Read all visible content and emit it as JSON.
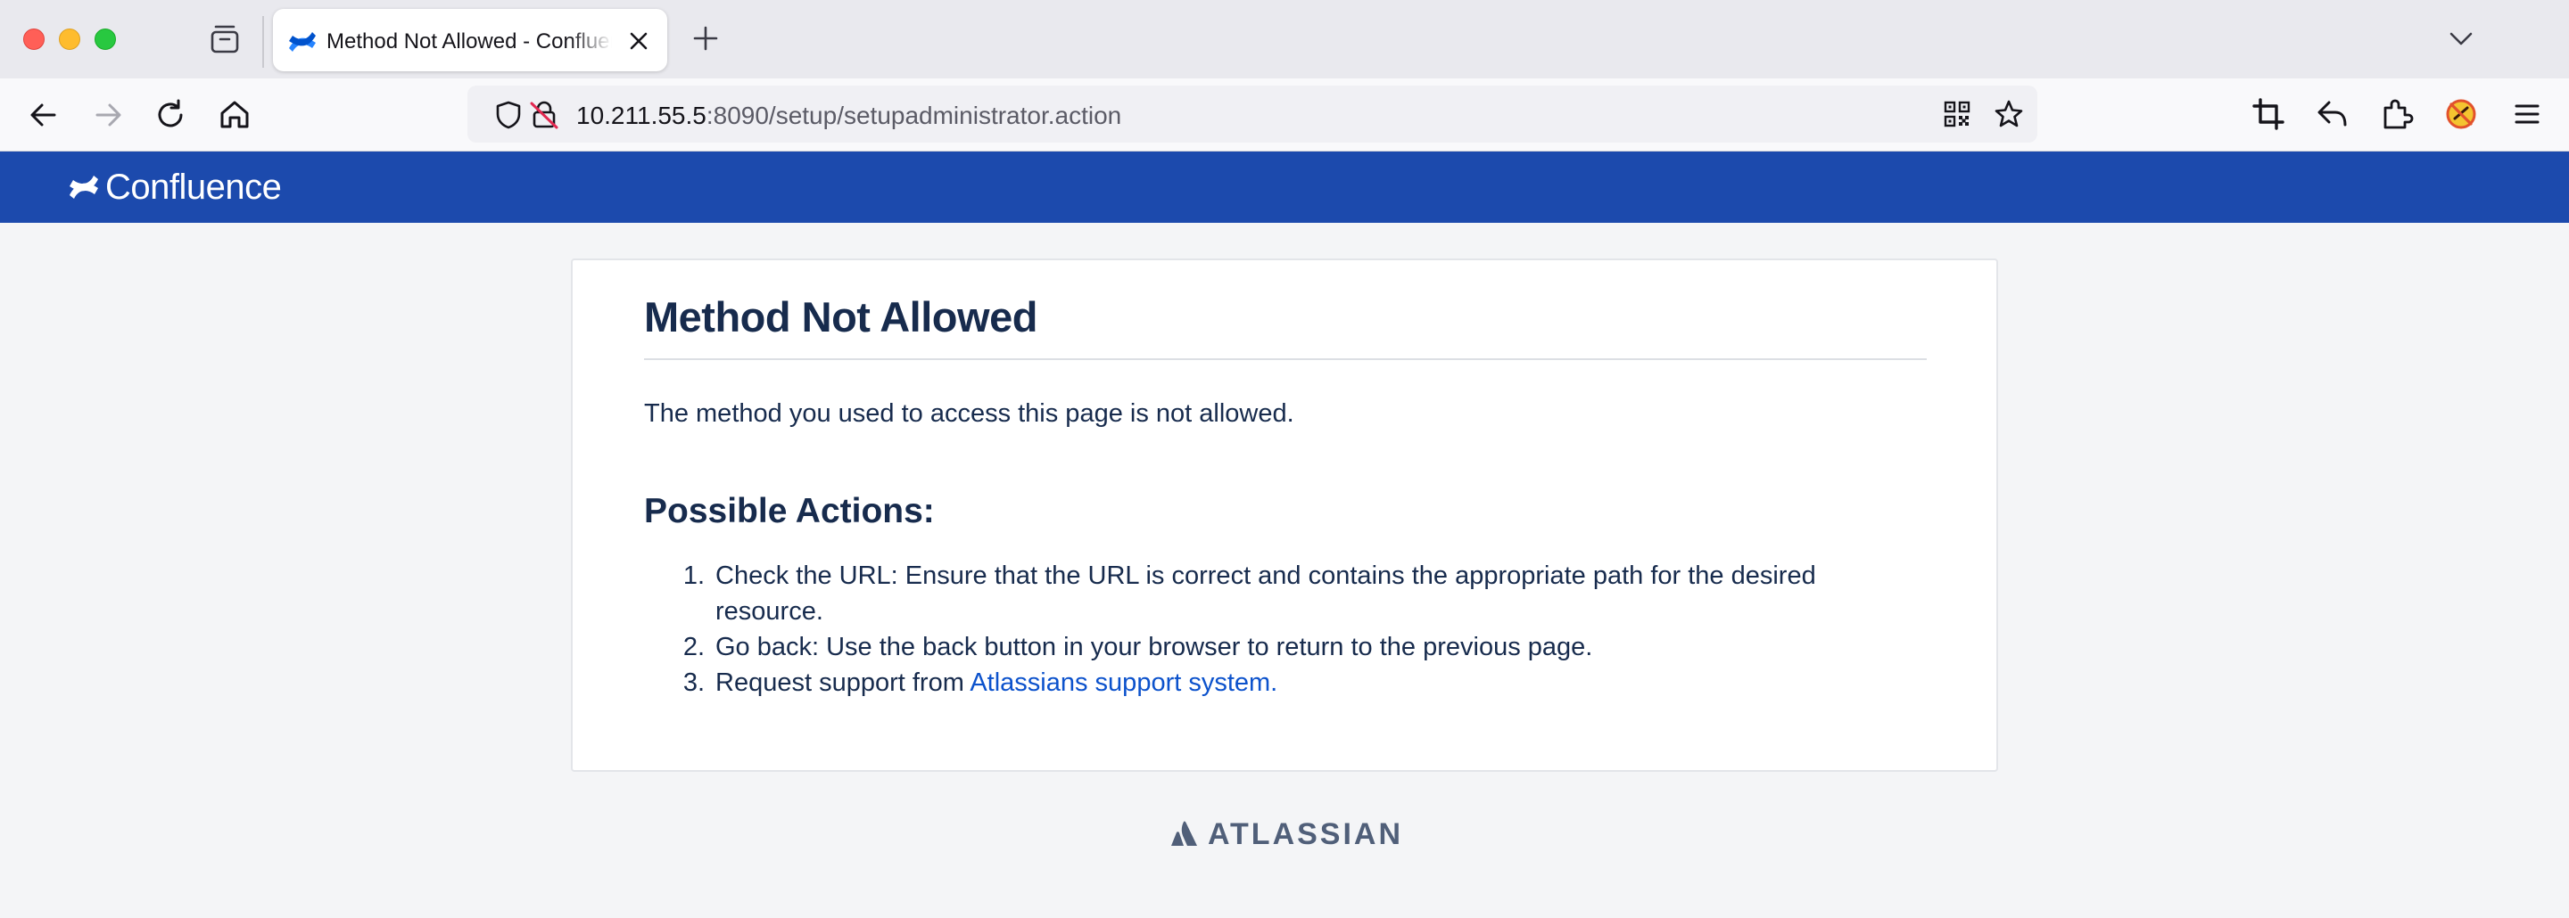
{
  "browser": {
    "tab_title": "Method Not Allowed - Confluence",
    "url_host": "10.211.55.5",
    "url_rest": ":8090/setup/setupadministrator.action"
  },
  "header": {
    "logo_text": "Confluence"
  },
  "error": {
    "title": "Method Not Allowed",
    "description": "The method you used to access this page is not allowed.",
    "actions_heading": "Possible Actions:",
    "actions": [
      {
        "num": "1.",
        "text": "Check the URL: Ensure that the URL is correct and contains the appropriate path for the desired resource."
      },
      {
        "num": "2.",
        "text": "Go back: Use the back button in your browser to return to the previous page."
      },
      {
        "num": "3.",
        "text": "Request support from ",
        "link": "Atlassians support system."
      }
    ]
  },
  "footer": {
    "brand": "ATLASSIAN"
  },
  "colors": {
    "header_blue": "#1c4aad",
    "heading_text": "#172b4d",
    "link": "#0c52cc",
    "footer_brand": "#505f79"
  }
}
